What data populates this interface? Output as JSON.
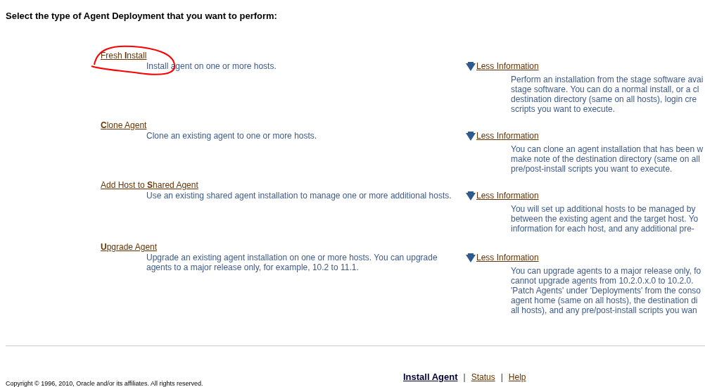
{
  "heading": "Select the type of Agent Deployment that you want to perform:",
  "options": [
    {
      "label": "Fresh **I**nstall",
      "description": [
        "Install agent on one or more hosts."
      ],
      "expanded": true,
      "toggle": "Less Information",
      "info": [
        "Perform an installation from the stage software avai",
        "stage software. You can do a normal install, or a cl",
        "destination directory (same on all hosts), login cre",
        "scripts you want to execute."
      ]
    },
    {
      "label": "**C**lone Agent",
      "description": [
        "Clone an existing agent to one or more hosts."
      ],
      "expanded": true,
      "toggle": "Less Information",
      "info": [
        "You can clone an agent installation that has been w",
        "make note of the destination directory (same on all",
        "pre/post-install scripts you want to execute."
      ]
    },
    {
      "label": "Add Host to **S**hared Agent",
      "description": [
        "Use an existing shared agent installation to manage one or more additional hosts."
      ],
      "expanded": true,
      "toggle": "Less Information",
      "info": [
        "You will set up additional hosts to be managed by",
        "between the existing agent and the target host. Yo",
        "information for each host, and any additional pre-"
      ]
    },
    {
      "label": "**U**pgrade Agent",
      "description": [
        "Upgrade an existing agent installation on one or more hosts. You can upgrade",
        "agents to a major release only, for example, 10.2 to 11.1."
      ],
      "expanded": true,
      "toggle": "Less Information",
      "info": [
        "You can upgrade agents to a major release only, fo",
        "cannot upgrade agents from 10.2.0.x.0 to 10.2.0.",
        "'Patch Agents' under 'Deployments' from the conso",
        "agent home (same on all hosts), the destination di",
        "all hosts), and any pre/post-install scripts you wan"
      ]
    }
  ],
  "footer": {
    "copyright": "Copyright © 1996, 2010, Oracle and/or its affiliates. All rights reserved.",
    "separator": "|",
    "links": [
      {
        "label": "Install Agent",
        "selected": true
      },
      {
        "label": "Status",
        "selected": false
      },
      {
        "label": "Help",
        "selected": false
      }
    ]
  }
}
